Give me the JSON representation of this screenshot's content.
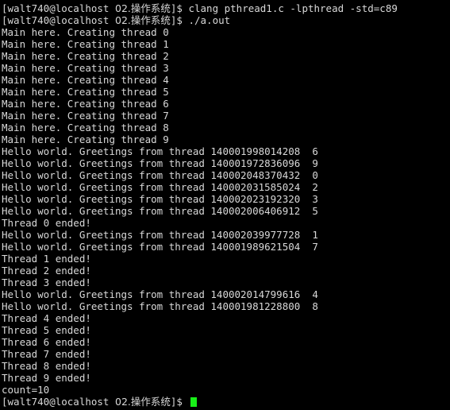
{
  "terminal": {
    "colors": {
      "background": "#000000",
      "foreground": "#d8d8d8",
      "cursor": "#18f018"
    },
    "prompt": {
      "user_host": "[walt740@localhost ",
      "directory": "02.操作系统",
      "suffix": "]$ "
    },
    "commands": {
      "compile": "clang pthread1.c -lpthread -std=c89",
      "run": "./a.out"
    },
    "lines": [
      {
        "type": "prompt",
        "command": "clang pthread1.c -lpthread -std=c89"
      },
      {
        "type": "prompt",
        "command": "./a.out"
      },
      {
        "type": "output",
        "text": "Main here. Creating thread 0"
      },
      {
        "type": "output",
        "text": "Main here. Creating thread 1"
      },
      {
        "type": "output",
        "text": "Main here. Creating thread 2"
      },
      {
        "type": "output",
        "text": "Main here. Creating thread 3"
      },
      {
        "type": "output",
        "text": "Main here. Creating thread 4"
      },
      {
        "type": "output",
        "text": "Main here. Creating thread 5"
      },
      {
        "type": "output",
        "text": "Main here. Creating thread 6"
      },
      {
        "type": "output",
        "text": "Main here. Creating thread 7"
      },
      {
        "type": "output",
        "text": "Main here. Creating thread 8"
      },
      {
        "type": "output",
        "text": "Main here. Creating thread 9"
      },
      {
        "type": "output",
        "text": "Hello world. Greetings from thread 140001998014208\t6"
      },
      {
        "type": "output",
        "text": "Hello world. Greetings from thread 140001972836096\t9"
      },
      {
        "type": "output",
        "text": "Hello world. Greetings from thread 140002048370432\t0"
      },
      {
        "type": "output",
        "text": "Hello world. Greetings from thread 140002031585024\t2"
      },
      {
        "type": "output",
        "text": "Hello world. Greetings from thread 140002023192320\t3"
      },
      {
        "type": "output",
        "text": "Hello world. Greetings from thread 140002006406912\t5"
      },
      {
        "type": "output",
        "text": "Thread 0 ended!"
      },
      {
        "type": "output",
        "text": "Hello world. Greetings from thread 140002039977728\t1"
      },
      {
        "type": "output",
        "text": "Hello world. Greetings from thread 140001989621504\t7"
      },
      {
        "type": "output",
        "text": "Thread 1 ended!"
      },
      {
        "type": "output",
        "text": "Thread 2 ended!"
      },
      {
        "type": "output",
        "text": "Thread 3 ended!"
      },
      {
        "type": "output",
        "text": "Hello world. Greetings from thread 140002014799616\t4"
      },
      {
        "type": "output",
        "text": "Hello world. Greetings from thread 140001981228800\t8"
      },
      {
        "type": "output",
        "text": "Thread 4 ended!"
      },
      {
        "type": "output",
        "text": "Thread 5 ended!"
      },
      {
        "type": "output",
        "text": "Thread 6 ended!"
      },
      {
        "type": "output",
        "text": "Thread 7 ended!"
      },
      {
        "type": "output",
        "text": "Thread 8 ended!"
      },
      {
        "type": "output",
        "text": "Thread 9 ended!"
      },
      {
        "type": "output",
        "text": "count=10"
      },
      {
        "type": "prompt",
        "command": "",
        "cursor": true
      }
    ]
  }
}
